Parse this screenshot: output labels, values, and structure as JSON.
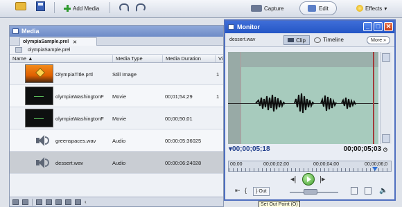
{
  "toolbar": {
    "add_media": "Add Media",
    "capture": "Capture",
    "edit": "Edit",
    "effects": "Effects"
  },
  "media": {
    "title": "Media",
    "tab_label": "olympiaSample.prel",
    "path_label": "olympiaSample.prel",
    "columns": [
      "Name",
      "Media Type",
      "Media Duration",
      "Vi"
    ],
    "rows": [
      {
        "name": "OlympiaTitle.prtl",
        "type": "Still Image",
        "duration": "",
        "vi": "1",
        "thumb": "title"
      },
      {
        "name": "olympiaWashingtonF",
        "type": "Movie",
        "duration": "00;01;54;29",
        "vi": "1",
        "thumb": "video"
      },
      {
        "name": "olympiaWashingtonF",
        "type": "Movie",
        "duration": "00;00;50;01",
        "vi": "",
        "thumb": "video"
      },
      {
        "name": "greenspaces.wav",
        "type": "Audio",
        "duration": "00:00:05:36025",
        "vi": "",
        "thumb": "audio"
      },
      {
        "name": "dessert.wav",
        "type": "Audio",
        "duration": "00:00:06:24028",
        "vi": "",
        "thumb": "audio",
        "selected": true
      }
    ]
  },
  "monitor": {
    "title": "Monitor",
    "clip_name": "dessert.wav",
    "clip_label": "Clip",
    "timeline_label": "Timeline",
    "more_label": "More",
    "current_time": "00;00;05;18",
    "duration_time": "00;00;05;03",
    "ruler": [
      "00;00",
      "00;00;02;00",
      "00;00;04;00",
      "00;00;06;0"
    ],
    "out_label": "Out",
    "tooltip": "Set Out Point (O)"
  },
  "colors": {
    "monitor_title": "#2456c6",
    "waveform_bg": "#a7cbbd",
    "out_marker": "#a23a3a",
    "play_green": "#3f9c2a"
  }
}
